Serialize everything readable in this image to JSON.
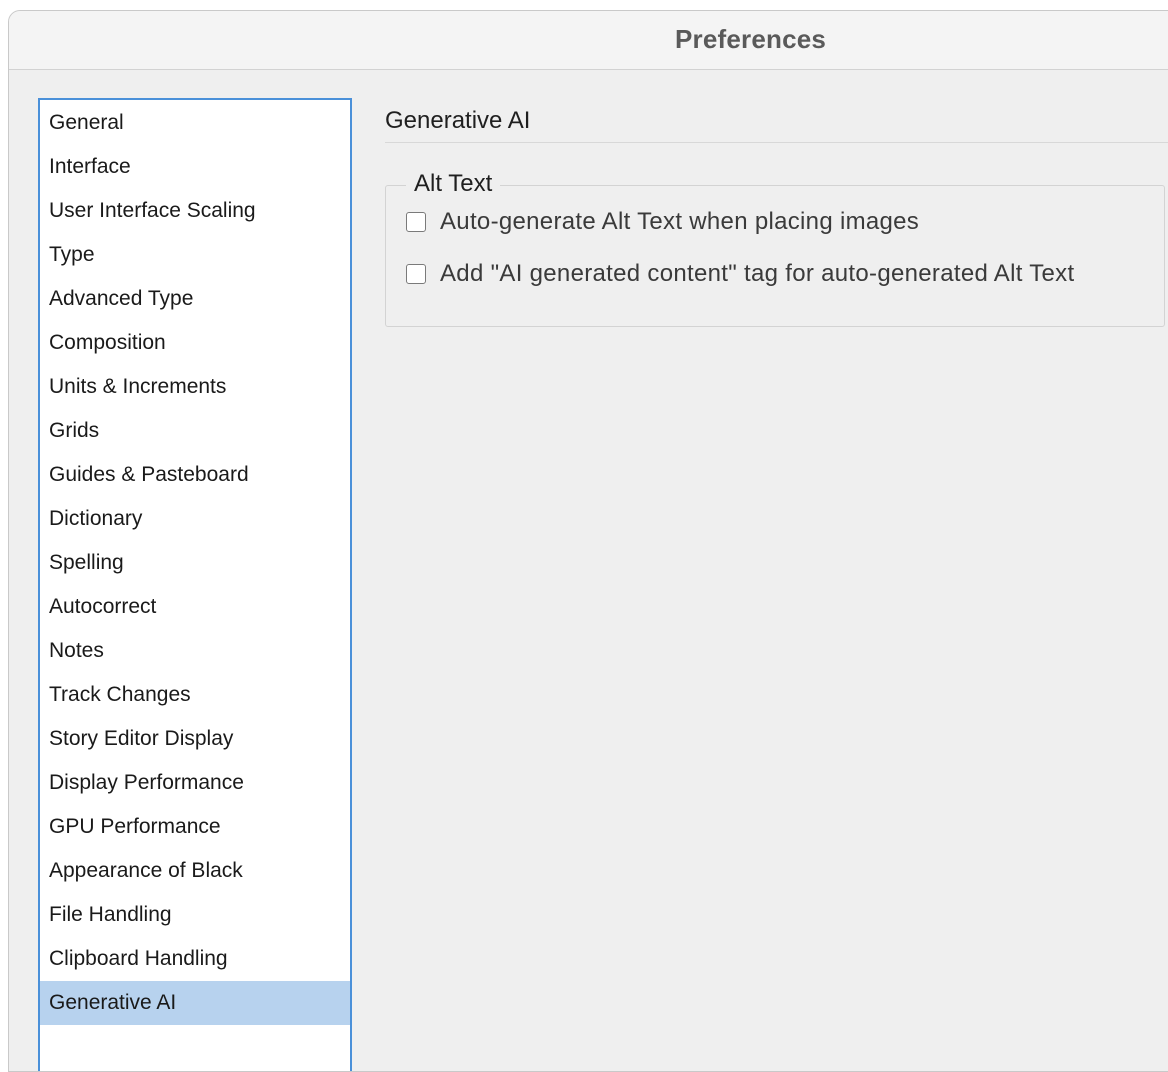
{
  "window": {
    "title": "Preferences"
  },
  "sidebar": {
    "items": [
      {
        "label": "General"
      },
      {
        "label": "Interface"
      },
      {
        "label": "User Interface Scaling"
      },
      {
        "label": "Type"
      },
      {
        "label": "Advanced Type"
      },
      {
        "label": "Composition"
      },
      {
        "label": "Units & Increments"
      },
      {
        "label": "Grids"
      },
      {
        "label": "Guides & Pasteboard"
      },
      {
        "label": "Dictionary"
      },
      {
        "label": "Spelling"
      },
      {
        "label": "Autocorrect"
      },
      {
        "label": "Notes"
      },
      {
        "label": "Track Changes"
      },
      {
        "label": "Story Editor Display"
      },
      {
        "label": "Display Performance"
      },
      {
        "label": "GPU Performance"
      },
      {
        "label": "Appearance of Black"
      },
      {
        "label": "File Handling"
      },
      {
        "label": "Clipboard Handling"
      },
      {
        "label": "Generative AI"
      }
    ],
    "selected": "Generative AI"
  },
  "main": {
    "section_title": "Generative AI",
    "alt_text_group": {
      "legend": "Alt Text",
      "options": [
        {
          "label": "Auto-generate Alt Text when placing images",
          "checked": false
        },
        {
          "label": "Add \"AI generated content\" tag for auto-generated Alt Text",
          "checked": false
        }
      ]
    }
  },
  "colors": {
    "selection_highlight": "#b7d2ee",
    "focus_border": "#4a90d9",
    "window_background": "#efefef"
  }
}
